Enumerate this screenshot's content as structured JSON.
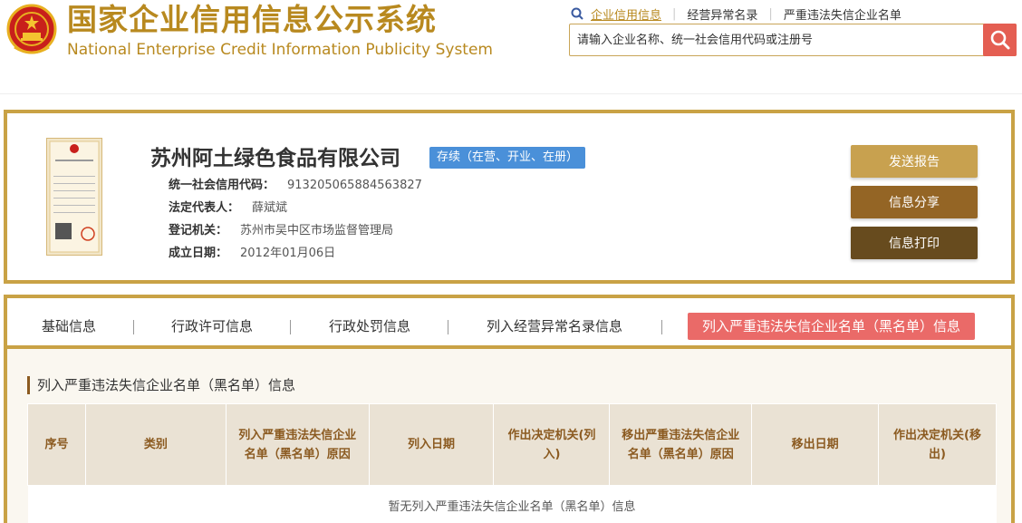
{
  "header": {
    "title_cn": "国家企业信用信息公示系统",
    "title_en": "National Enterprise Credit Information Publicity System",
    "links": [
      "企业信用信息",
      "经营异常名录",
      "严重违法失信企业名单"
    ],
    "search_placeholder": "请输入企业名称、统一社会信用代码或注册号"
  },
  "company": {
    "name": "苏州阿土绿色食品有限公司",
    "status": "存续（在营、开业、在册）",
    "credit_code_label": "统一社会信用代码：",
    "credit_code": "913205065884563827",
    "legal_rep_label": "法定代表人：",
    "legal_rep": "薛斌斌",
    "authority_label": "登记机关：",
    "authority": "苏州市吴中区市场监督管理局",
    "est_date_label": "成立日期：",
    "est_date": "2012年01月06日",
    "license_title": "营业执照"
  },
  "actions": {
    "send_report": "发送报告",
    "share": "信息分享",
    "print": "信息打印"
  },
  "tabs": [
    "基础信息",
    "行政许可信息",
    "行政处罚信息",
    "列入经营异常名录信息",
    "列入严重违法失信企业名单（黑名单）信息"
  ],
  "section": {
    "title": "列入严重违法失信企业名单（黑名单）信息",
    "columns": [
      "序号",
      "类别",
      "列入严重违法失信企业名单（黑名单）原因",
      "列入日期",
      "作出决定机关(列入)",
      "移出严重违法失信企业名单（黑名单）原因",
      "移出日期",
      "作出决定机关(移出)"
    ],
    "empty_text": "暂无列入严重违法失信企业名单（黑名单）信息"
  },
  "colors": {
    "gold": "#c9a245",
    "title_gold": "#b8891f",
    "badge_blue": "#4a90d9",
    "active_tab": "#ea6a68",
    "search_red": "#e45e52"
  },
  "icons": [
    "national-emblem-icon",
    "search-icon",
    "license-thumbnail"
  ]
}
